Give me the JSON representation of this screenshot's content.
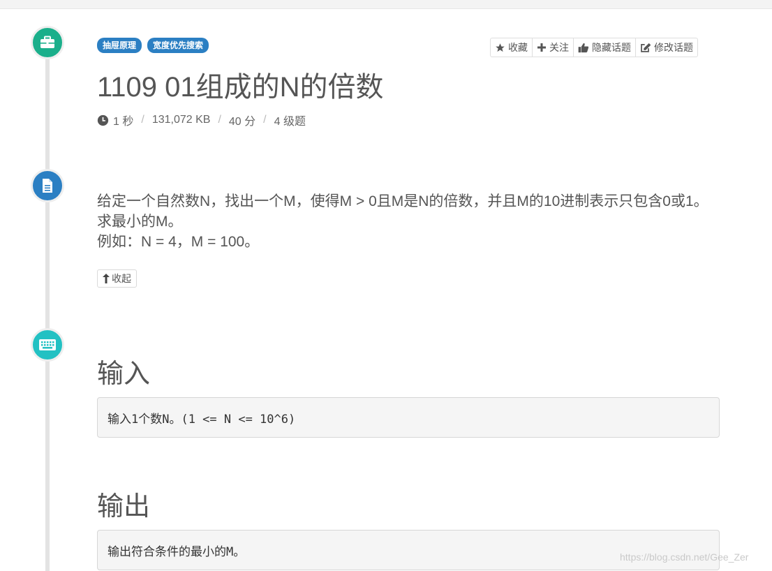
{
  "tags": [
    "抽屉原理",
    "宽度优先搜索"
  ],
  "actions": [
    {
      "icon": "star-icon",
      "label": "收藏"
    },
    {
      "icon": "plus-icon",
      "label": "关注"
    },
    {
      "icon": "thumbs-up-icon",
      "label": "隐藏话题"
    },
    {
      "icon": "edit-icon",
      "label": "修改话题"
    }
  ],
  "problem": {
    "title": "1109 01组成的N的倍数",
    "time": "1 秒",
    "memory": "131,072 KB",
    "score": "40 分",
    "level": "4 级题"
  },
  "description": {
    "line1": "给定一个自然数N，找出一个M，使得M > 0且M是N的倍数，并且M的10进制表示只包含0或1。求最小的M。",
    "line2": "例如：N = 4，M = 100。"
  },
  "collapse_label": "收起",
  "input": {
    "heading": "输入",
    "content": "输入1个数N。(1 <= N <= 10^6)"
  },
  "output": {
    "heading": "输出",
    "content": "输出符合条件的最小的M。"
  },
  "watermark": "https://blog.csdn.net/Gee_Zer",
  "colors": {
    "tag_bg": "#2b7fc3",
    "timeline_green": "#1aaf8b",
    "timeline_blue": "#2b7fc3",
    "timeline_teal": "#22c1c3"
  }
}
